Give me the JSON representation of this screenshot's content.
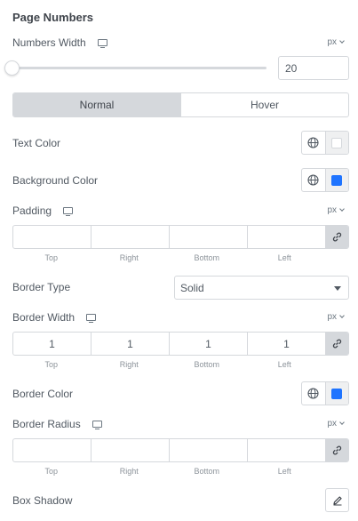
{
  "section_title": "Page Numbers",
  "numbers_width": {
    "label": "Numbers Width",
    "unit": "px",
    "value": "20",
    "slider_fraction": 0
  },
  "state_tabs": [
    {
      "label": "Normal",
      "active": true
    },
    {
      "label": "Hover",
      "active": false
    }
  ],
  "text_color": {
    "label": "Text Color",
    "swatch": "#ffffff"
  },
  "background_color": {
    "label": "Background Color",
    "swatch": "#1f74ff"
  },
  "padding": {
    "label": "Padding",
    "unit": "px",
    "values": [
      "",
      "",
      "",
      ""
    ],
    "sides": [
      "Top",
      "Right",
      "Bottom",
      "Left"
    ]
  },
  "border_type": {
    "label": "Border Type",
    "value": "Solid"
  },
  "border_width": {
    "label": "Border Width",
    "unit": "px",
    "values": [
      "1",
      "1",
      "1",
      "1"
    ],
    "sides": [
      "Top",
      "Right",
      "Bottom",
      "Left"
    ]
  },
  "border_color": {
    "label": "Border Color",
    "swatch": "#1f74ff"
  },
  "border_radius": {
    "label": "Border Radius",
    "unit": "px",
    "values": [
      "",
      "",
      "",
      ""
    ],
    "sides": [
      "Top",
      "Right",
      "Bottom",
      "Left"
    ]
  },
  "box_shadow": {
    "label": "Box Shadow"
  },
  "icons": {
    "responsive": "desktop-icon",
    "global": "globe-icon",
    "link": "link-icon",
    "edit": "pencil-icon",
    "unit_dropdown": "chevron-down-icon"
  }
}
